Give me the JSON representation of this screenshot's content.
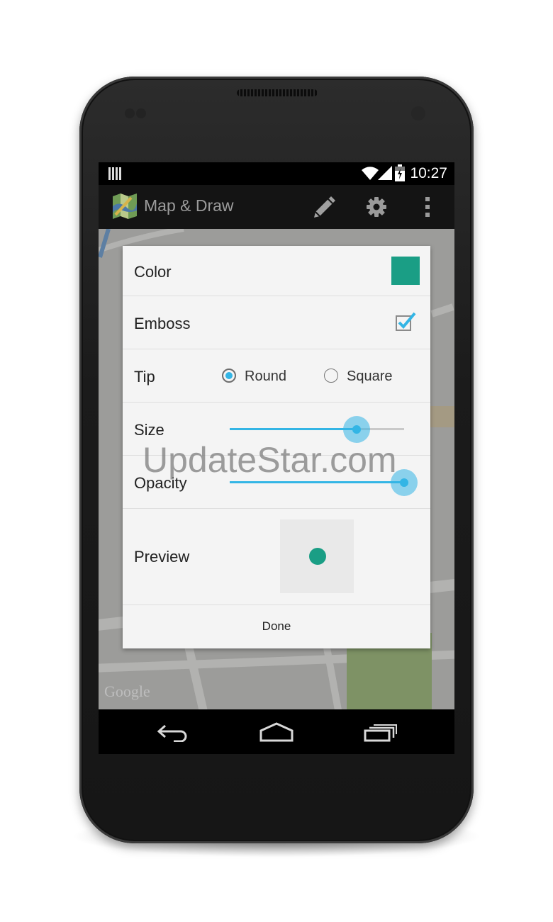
{
  "status_bar": {
    "time": "10:27"
  },
  "action_bar": {
    "title": "Map & Draw"
  },
  "map": {
    "attribution": "Google"
  },
  "dialog": {
    "color_label": "Color",
    "color_value": "#1a9e85",
    "emboss_label": "Emboss",
    "emboss_checked": true,
    "tip_label": "Tip",
    "tip_options": [
      {
        "label": "Round",
        "selected": true
      },
      {
        "label": "Square",
        "selected": false
      }
    ],
    "size_label": "Size",
    "size_value": 0.72,
    "opacity_label": "Opacity",
    "opacity_value": 1.0,
    "preview_label": "Preview",
    "done_label": "Done"
  },
  "watermark": "UpdateStar.com",
  "colors": {
    "accent": "#33b5e5",
    "brush": "#1a9e85"
  }
}
